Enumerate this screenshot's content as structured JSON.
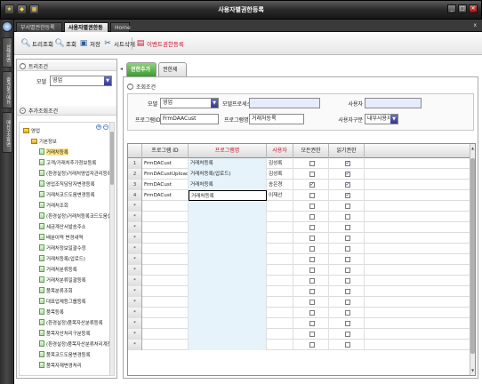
{
  "window": {
    "title": "사용자별권한등록"
  },
  "titlebar": {
    "icon1": "★",
    "icon2": "◆",
    "icon3": "▦"
  },
  "left_dock": {
    "tabs": [
      "선택화면",
      "즐겨찾기메뉴",
      "메뉴구조화면"
    ]
  },
  "doc_tabs": [
    {
      "label": "부서별권한등록"
    },
    {
      "label": "사용자별권한등록"
    },
    {
      "label": "Home"
    }
  ],
  "doc_tabs_close": "x",
  "toolbar": {
    "tree_search": "트리조회",
    "search": "조회",
    "save": "저장",
    "delete_sheet": "시트삭제",
    "event_permission": "이벤트권한등록"
  },
  "left_panel": {
    "tree_cond_header": "트리조건",
    "model_label": "모델",
    "model_value": "영업",
    "extra_cond_header": "추가조회조건",
    "tree_nodes": [
      {
        "label": "영업",
        "level": 0,
        "folder": true
      },
      {
        "label": "기본정보",
        "level": 1,
        "folder": true
      },
      {
        "label": "거래처등록",
        "level": 2,
        "folder": false,
        "selected": true
      },
      {
        "label": "고객/거래처추가정보등록",
        "level": 2,
        "folder": false
      },
      {
        "label": "(환경설정)거래처영업자관리등록",
        "level": 2,
        "folder": false
      },
      {
        "label": "영업조직담당자변경등록",
        "level": 2,
        "folder": false
      },
      {
        "label": "거래처코드도움변경등록",
        "level": 2,
        "folder": false
      },
      {
        "label": "거래처조회",
        "level": 2,
        "folder": false
      },
      {
        "label": "(환경설정)거래처등록코드도움설정",
        "level": 2,
        "folder": false
      },
      {
        "label": "세금계산서발송주소",
        "level": 2,
        "folder": false
      },
      {
        "label": "배분이력 변경내역",
        "level": 2,
        "folder": false
      },
      {
        "label": "거래처정보일괄수정",
        "level": 2,
        "folder": false
      },
      {
        "label": "거래처등록(업로드)",
        "level": 2,
        "folder": false
      },
      {
        "label": "거래처분류등록",
        "level": 2,
        "folder": false
      },
      {
        "label": "거래처분류일괄등록",
        "level": 2,
        "folder": false
      },
      {
        "label": "품목분류조회",
        "level": 2,
        "folder": false
      },
      {
        "label": "대표업체등그룹등록",
        "level": 2,
        "folder": false
      },
      {
        "label": "품목등록",
        "level": 2,
        "folder": false
      },
      {
        "label": "(환경설정)품목자산분류등록",
        "level": 2,
        "folder": false
      },
      {
        "label": "품목자산처리구분등록",
        "level": 2,
        "folder": false
      },
      {
        "label": "(환경설정)품목자산분류처리계정등록",
        "level": 2,
        "folder": false
      },
      {
        "label": "품목코드도움변경등록",
        "level": 2,
        "folder": false
      },
      {
        "label": "품목자재변경처리",
        "level": 2,
        "folder": false
      }
    ]
  },
  "right_tabs": [
    {
      "label": "권한추가"
    },
    {
      "label": "권한제외"
    }
  ],
  "conditions": {
    "header": "조회조건",
    "model_label": "모델",
    "model_value": "영업",
    "model_process_label": "모델프로세스",
    "model_process_value": "",
    "user_label": "사용자",
    "user_value": "",
    "program_id_label": "프로그램ID",
    "program_id_value": "FrmDAACust",
    "program_name_label": "프로그램명",
    "program_name_value": "거래처등록",
    "user_type_label": "사용자구분",
    "user_type_value": "내부사용자"
  },
  "grid": {
    "headers": [
      "프로그램 ID",
      "프로그램명",
      "사용자",
      "모든권한",
      "읽기권한"
    ],
    "rows": [
      {
        "num": "1",
        "id": "FrmDACust",
        "name": "거래처등록",
        "user": "김성록",
        "all": false,
        "read": true
      },
      {
        "num": "2",
        "id": "FrmDACustUpload",
        "name": "거래처등록(업로드)",
        "user": "김성록",
        "all": false,
        "read": true
      },
      {
        "num": "3",
        "id": "FrmDACust",
        "name": "거래처등록",
        "user": "송은경",
        "all": true,
        "read": true
      },
      {
        "num": "4",
        "id": "FrmDACust",
        "name": "거래처등록",
        "user": "이재선",
        "all": false,
        "read": true
      }
    ],
    "empty_rows": 14,
    "row_marker": "*"
  },
  "colors": {
    "accent_green": "#3d9a2e",
    "accent_red": "#c8102e",
    "name_column_bg": "#e6f3fb"
  }
}
